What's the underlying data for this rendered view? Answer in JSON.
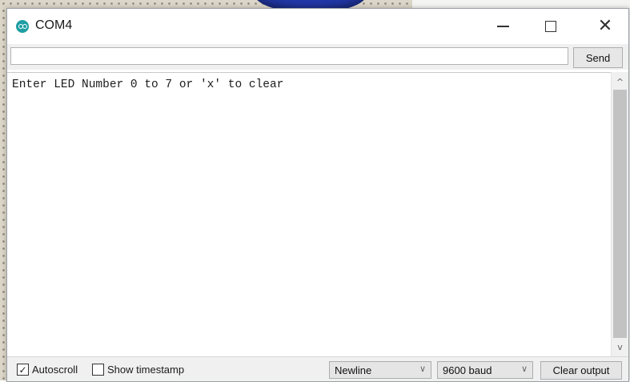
{
  "window": {
    "title": "COM4",
    "app_icon": "arduino-icon",
    "controls": {
      "minimize": "minimize-icon",
      "maximize": "maximize-icon",
      "close_glyph": "✕"
    }
  },
  "send_bar": {
    "input_value": "",
    "send_label": "Send"
  },
  "output": {
    "lines": [
      "Enter LED Number 0 to 7 or 'x' to clear"
    ]
  },
  "scrollbar": {
    "up_glyph": "^",
    "down_glyph": "v"
  },
  "footer": {
    "autoscroll_label": "Autoscroll",
    "autoscroll_checked": true,
    "autoscroll_check_glyph": "✓",
    "timestamp_label": "Show timestamp",
    "timestamp_checked": false,
    "line_ending": "Newline",
    "baud_rate": "9600 baud",
    "dropdown_glyph": "∨",
    "clear_label": "Clear output"
  },
  "colors": {
    "app_icon": "#1f9ea3",
    "window_bg": "#ffffff",
    "chrome_bg": "#f0f0f0",
    "button_bg": "#e5e5e5"
  }
}
